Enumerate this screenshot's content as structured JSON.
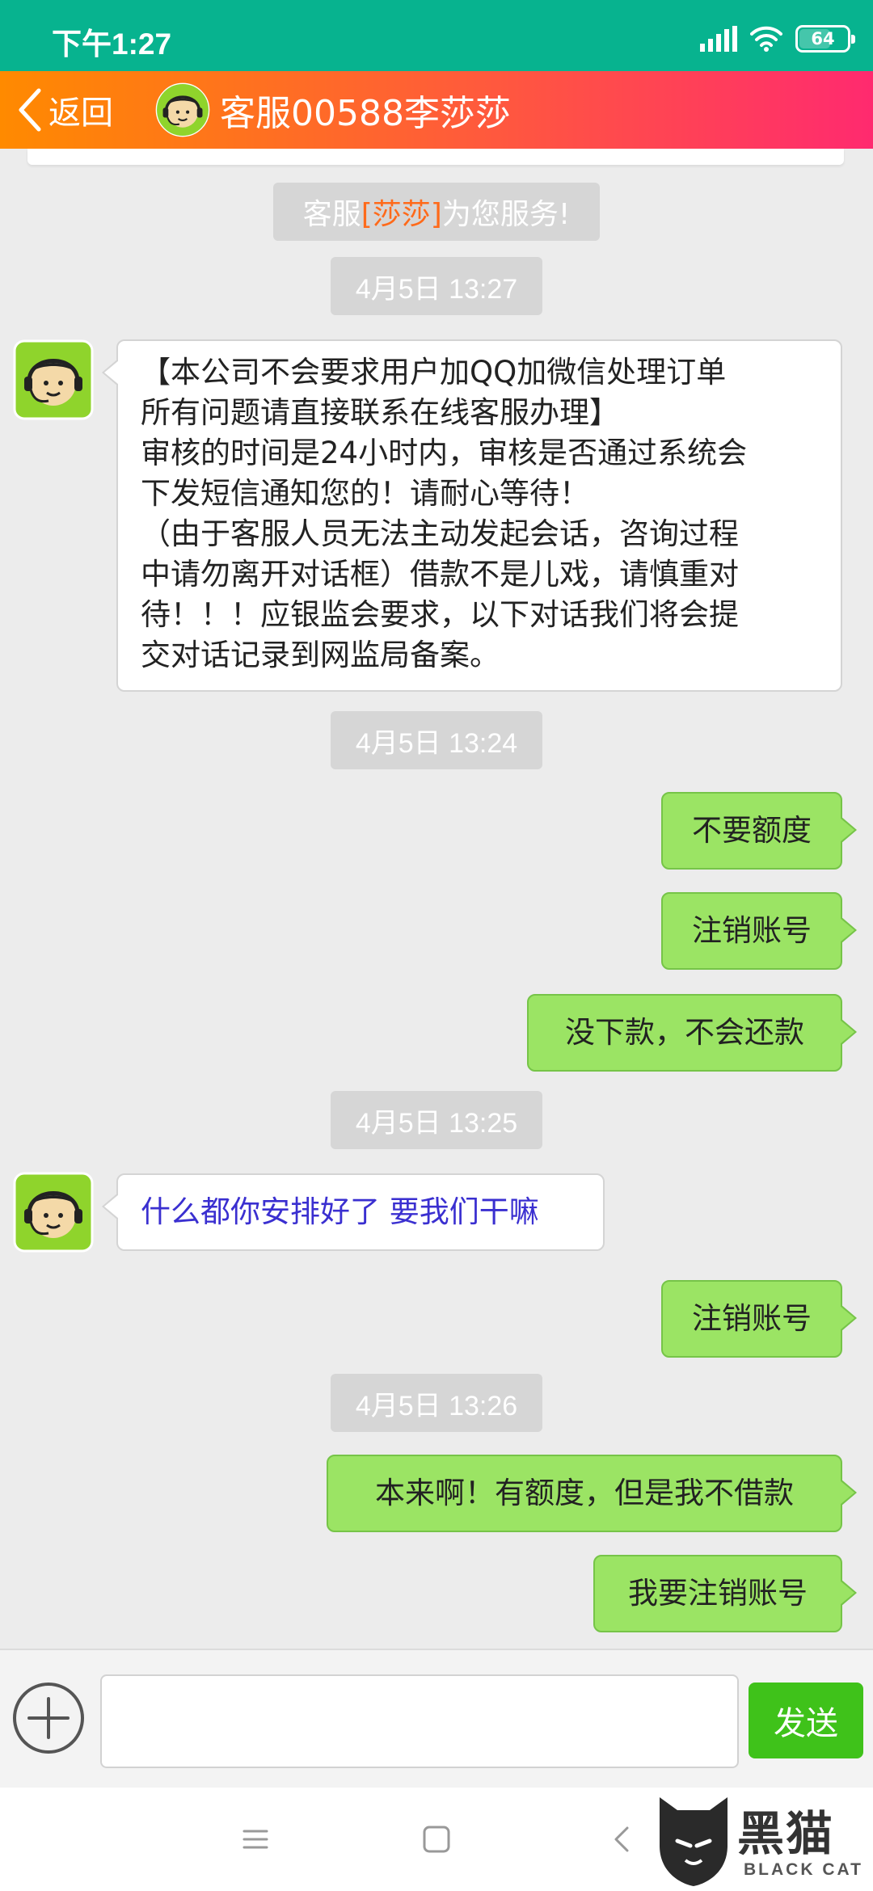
{
  "status_bar": {
    "time": "下午1:27",
    "battery": "64",
    "icons": [
      "signal-icon",
      "wifi-icon",
      "battery-icon"
    ]
  },
  "header": {
    "back_label": "返回",
    "title": "客服00588李莎莎",
    "avatar": "agent-avatar-icon"
  },
  "notice": {
    "prefix": "客服",
    "name": "[莎莎]",
    "suffix": "为您服务!"
  },
  "timestamps": [
    "4月5日 13:27",
    "4月5日 13:24",
    "4月5日 13:25",
    "4月5日 13:26"
  ],
  "messages": {
    "m1": {
      "lines": [
        "【本公司不会要求用户加QQ加微信处理订单",
        "所有问题请直接联系在线客服办理】",
        "审核的时间是24小时内，审核是否通过系统会",
        "下发短信通知您的！请耐心等待！",
        "（由于客服人员无法主动发起会话，咨询过程",
        "中请勿离开对话框）借款不是儿戏，请慎重对",
        "待！！！应银监会要求，以下对话我们将会提",
        "交对话记录到网监局备案。"
      ]
    },
    "m2": "不要额度",
    "m3": "注销账号",
    "m4": "没下款，不会还款",
    "m5": "什么都你安排好了 要我们干嘛",
    "m6": "注销账号",
    "m7": "本来啊！有额度，但是我不借款",
    "m8": "我要注销账号"
  },
  "input_bar": {
    "placeholder": "",
    "send_label": "发送"
  },
  "nav_bar": {
    "icons": [
      "menu-icon",
      "home-icon",
      "back-icon"
    ]
  },
  "watermark": {
    "text": "黑猫",
    "sub": "BLACK CAT"
  },
  "colors": {
    "status_bar": "#07b38f",
    "header_start": "#ff8a00",
    "header_end": "#ff2a6f",
    "outgoing_bubble": "#9be464",
    "send_button": "#3fc21a",
    "agent_text_highlight": "#3a2fd0"
  }
}
